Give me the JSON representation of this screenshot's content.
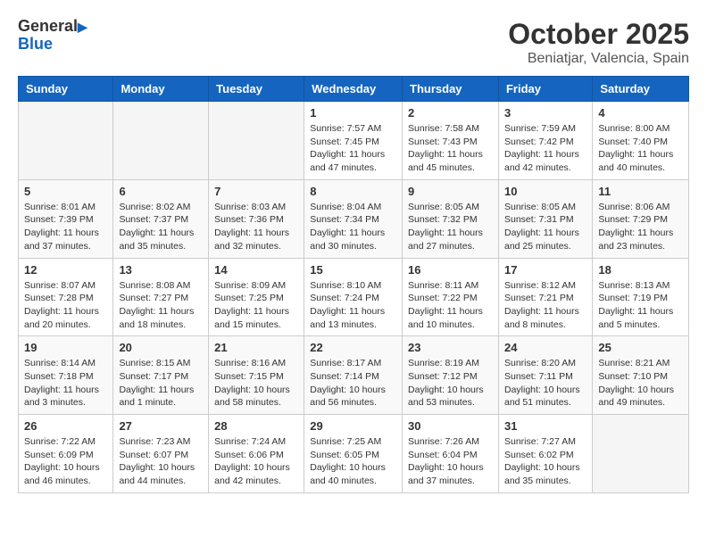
{
  "header": {
    "logo_general": "General",
    "logo_blue": "Blue",
    "month_title": "October 2025",
    "subtitle": "Beniatjar, Valencia, Spain"
  },
  "days_of_week": [
    "Sunday",
    "Monday",
    "Tuesday",
    "Wednesday",
    "Thursday",
    "Friday",
    "Saturday"
  ],
  "weeks": [
    [
      {
        "day": "",
        "info": ""
      },
      {
        "day": "",
        "info": ""
      },
      {
        "day": "",
        "info": ""
      },
      {
        "day": "1",
        "info": "Sunrise: 7:57 AM\nSunset: 7:45 PM\nDaylight: 11 hours\nand 47 minutes."
      },
      {
        "day": "2",
        "info": "Sunrise: 7:58 AM\nSunset: 7:43 PM\nDaylight: 11 hours\nand 45 minutes."
      },
      {
        "day": "3",
        "info": "Sunrise: 7:59 AM\nSunset: 7:42 PM\nDaylight: 11 hours\nand 42 minutes."
      },
      {
        "day": "4",
        "info": "Sunrise: 8:00 AM\nSunset: 7:40 PM\nDaylight: 11 hours\nand 40 minutes."
      }
    ],
    [
      {
        "day": "5",
        "info": "Sunrise: 8:01 AM\nSunset: 7:39 PM\nDaylight: 11 hours\nand 37 minutes."
      },
      {
        "day": "6",
        "info": "Sunrise: 8:02 AM\nSunset: 7:37 PM\nDaylight: 11 hours\nand 35 minutes."
      },
      {
        "day": "7",
        "info": "Sunrise: 8:03 AM\nSunset: 7:36 PM\nDaylight: 11 hours\nand 32 minutes."
      },
      {
        "day": "8",
        "info": "Sunrise: 8:04 AM\nSunset: 7:34 PM\nDaylight: 11 hours\nand 30 minutes."
      },
      {
        "day": "9",
        "info": "Sunrise: 8:05 AM\nSunset: 7:32 PM\nDaylight: 11 hours\nand 27 minutes."
      },
      {
        "day": "10",
        "info": "Sunrise: 8:05 AM\nSunset: 7:31 PM\nDaylight: 11 hours\nand 25 minutes."
      },
      {
        "day": "11",
        "info": "Sunrise: 8:06 AM\nSunset: 7:29 PM\nDaylight: 11 hours\nand 23 minutes."
      }
    ],
    [
      {
        "day": "12",
        "info": "Sunrise: 8:07 AM\nSunset: 7:28 PM\nDaylight: 11 hours\nand 20 minutes."
      },
      {
        "day": "13",
        "info": "Sunrise: 8:08 AM\nSunset: 7:27 PM\nDaylight: 11 hours\nand 18 minutes."
      },
      {
        "day": "14",
        "info": "Sunrise: 8:09 AM\nSunset: 7:25 PM\nDaylight: 11 hours\nand 15 minutes."
      },
      {
        "day": "15",
        "info": "Sunrise: 8:10 AM\nSunset: 7:24 PM\nDaylight: 11 hours\nand 13 minutes."
      },
      {
        "day": "16",
        "info": "Sunrise: 8:11 AM\nSunset: 7:22 PM\nDaylight: 11 hours\nand 10 minutes."
      },
      {
        "day": "17",
        "info": "Sunrise: 8:12 AM\nSunset: 7:21 PM\nDaylight: 11 hours\nand 8 minutes."
      },
      {
        "day": "18",
        "info": "Sunrise: 8:13 AM\nSunset: 7:19 PM\nDaylight: 11 hours\nand 5 minutes."
      }
    ],
    [
      {
        "day": "19",
        "info": "Sunrise: 8:14 AM\nSunset: 7:18 PM\nDaylight: 11 hours\nand 3 minutes."
      },
      {
        "day": "20",
        "info": "Sunrise: 8:15 AM\nSunset: 7:17 PM\nDaylight: 11 hours\nand 1 minute."
      },
      {
        "day": "21",
        "info": "Sunrise: 8:16 AM\nSunset: 7:15 PM\nDaylight: 10 hours\nand 58 minutes."
      },
      {
        "day": "22",
        "info": "Sunrise: 8:17 AM\nSunset: 7:14 PM\nDaylight: 10 hours\nand 56 minutes."
      },
      {
        "day": "23",
        "info": "Sunrise: 8:19 AM\nSunset: 7:12 PM\nDaylight: 10 hours\nand 53 minutes."
      },
      {
        "day": "24",
        "info": "Sunrise: 8:20 AM\nSunset: 7:11 PM\nDaylight: 10 hours\nand 51 minutes."
      },
      {
        "day": "25",
        "info": "Sunrise: 8:21 AM\nSunset: 7:10 PM\nDaylight: 10 hours\nand 49 minutes."
      }
    ],
    [
      {
        "day": "26",
        "info": "Sunrise: 7:22 AM\nSunset: 6:09 PM\nDaylight: 10 hours\nand 46 minutes."
      },
      {
        "day": "27",
        "info": "Sunrise: 7:23 AM\nSunset: 6:07 PM\nDaylight: 10 hours\nand 44 minutes."
      },
      {
        "day": "28",
        "info": "Sunrise: 7:24 AM\nSunset: 6:06 PM\nDaylight: 10 hours\nand 42 minutes."
      },
      {
        "day": "29",
        "info": "Sunrise: 7:25 AM\nSunset: 6:05 PM\nDaylight: 10 hours\nand 40 minutes."
      },
      {
        "day": "30",
        "info": "Sunrise: 7:26 AM\nSunset: 6:04 PM\nDaylight: 10 hours\nand 37 minutes."
      },
      {
        "day": "31",
        "info": "Sunrise: 7:27 AM\nSunset: 6:02 PM\nDaylight: 10 hours\nand 35 minutes."
      },
      {
        "day": "",
        "info": ""
      }
    ]
  ]
}
